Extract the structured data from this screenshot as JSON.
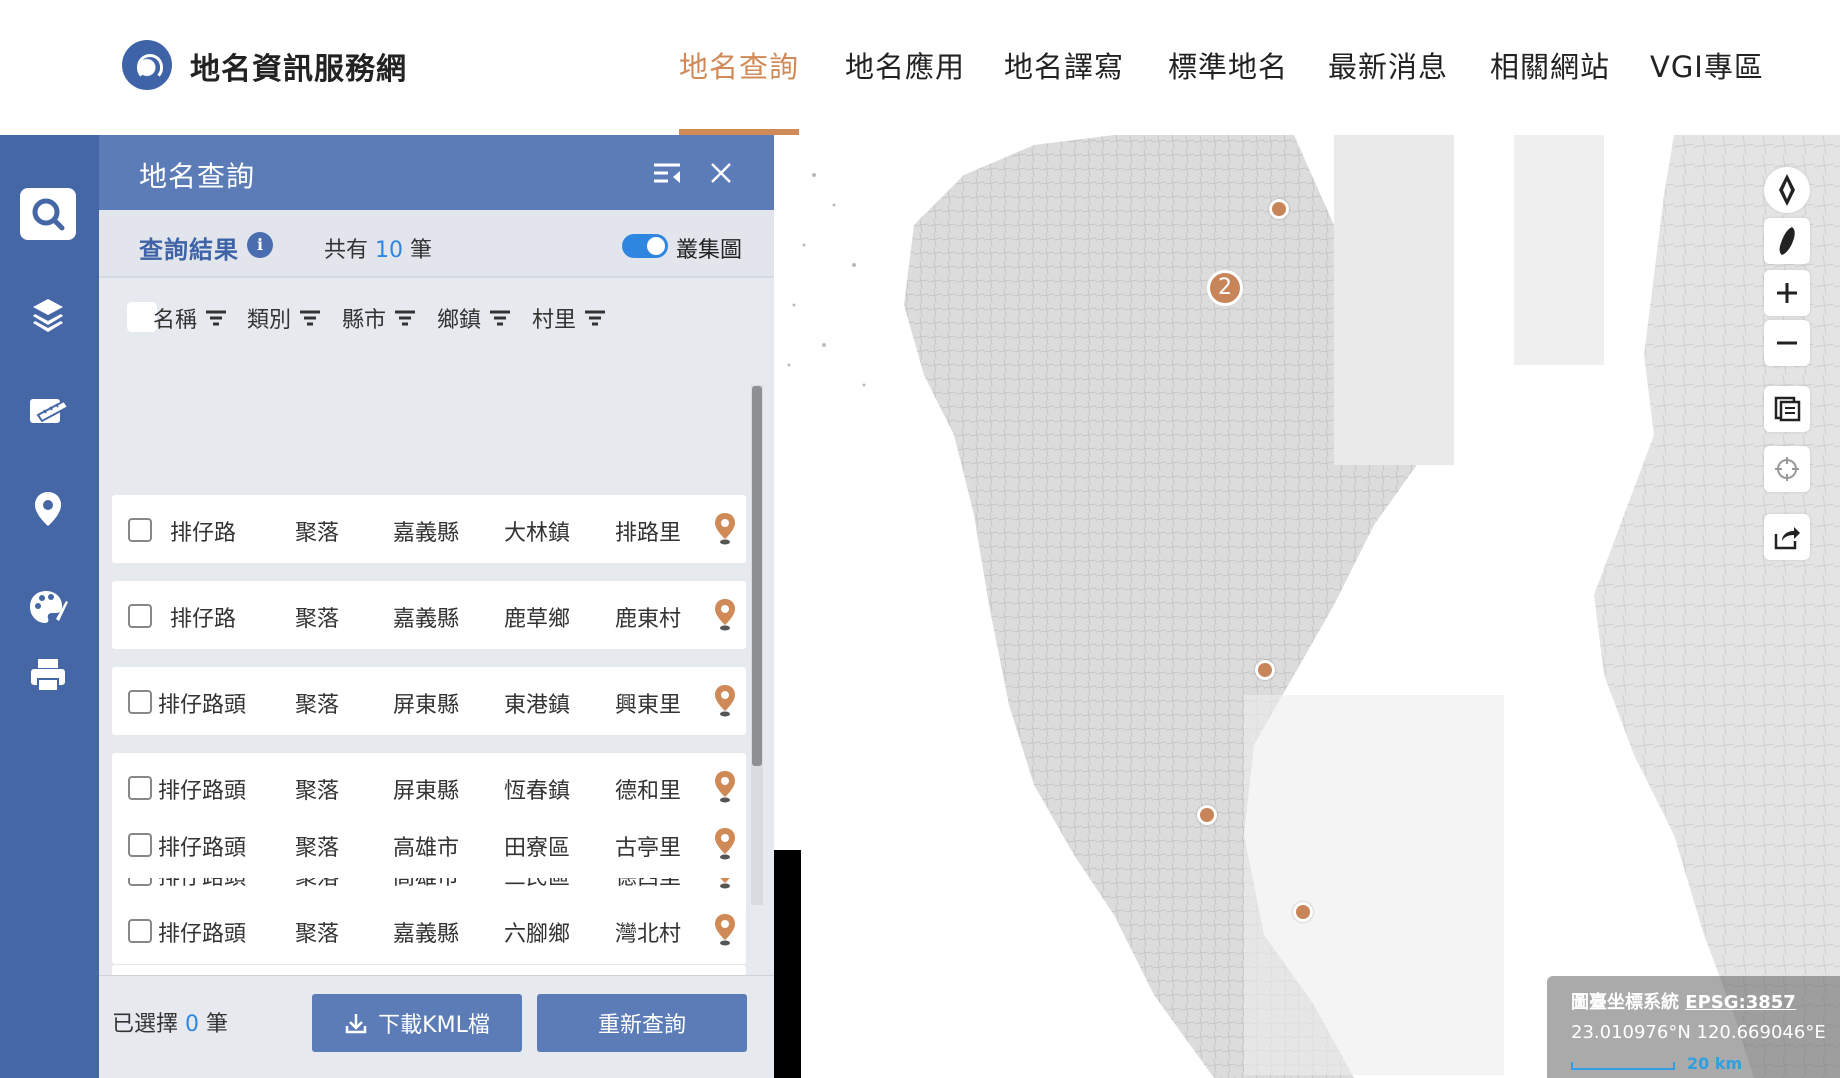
{
  "site": {
    "title": "地名資訊服務網"
  },
  "nav": {
    "items": [
      {
        "label": "地名查詢",
        "active": true
      },
      {
        "label": "地名應用",
        "active": false
      },
      {
        "label": "地名譯寫",
        "active": false
      },
      {
        "label": "標準地名",
        "active": false
      },
      {
        "label": "最新消息",
        "active": false
      },
      {
        "label": "相關網站",
        "active": false
      },
      {
        "label": "VGI專區",
        "active": false
      }
    ]
  },
  "rail": {
    "icons": [
      "search-icon",
      "layers-icon",
      "measure-icon",
      "location-pin-icon",
      "palette-icon",
      "print-icon"
    ]
  },
  "panel": {
    "title": "地名查詢",
    "result_title": "查詢結果",
    "count_prefix": "共有",
    "count": "10",
    "count_suffix": "筆",
    "cluster_label": "叢集圖",
    "cluster_on": true,
    "columns": [
      "名稱",
      "類別",
      "縣市",
      "鄉鎮",
      "村里"
    ],
    "rows": [
      {
        "name": "排仔路",
        "type": "聚落",
        "county": "嘉義縣",
        "town": "大林鎮",
        "village": "排路里"
      },
      {
        "name": "排仔路",
        "type": "聚落",
        "county": "嘉義縣",
        "town": "鹿草鄉",
        "village": "鹿東村"
      },
      {
        "name": "排仔路頭",
        "type": "聚落",
        "county": "屏東縣",
        "town": "東港鎮",
        "village": "興東里"
      },
      {
        "name": "排仔路頭",
        "type": "聚落",
        "county": "屏東縣",
        "town": "恆春鎮",
        "village": "德和里"
      },
      {
        "name": "排仔路頭",
        "type": "聚落",
        "county": "高雄市",
        "town": "三民區",
        "village": "德西里"
      },
      {
        "name": "排仔路頭",
        "type": "聚落",
        "county": "高雄市",
        "town": "田寮區",
        "village": "古亭里"
      },
      {
        "name": "排仔路頭",
        "type": "聚落",
        "county": "嘉義縣",
        "town": "六腳鄉",
        "village": "灣北村"
      }
    ],
    "footer": {
      "selected_prefix": "已選擇",
      "selected_count": "0",
      "selected_suffix": "筆",
      "download_label": "下載KML檔",
      "requery_label": "重新查詢"
    }
  },
  "map": {
    "cluster_count": "2",
    "controls": [
      "compass-icon",
      "taiwan-icon",
      "zoom-in-icon",
      "zoom-out-icon",
      "legend-icon",
      "locate-icon",
      "share-icon"
    ],
    "coord_system_label": "圖臺坐標系統",
    "coord_system_code": "EPSG:3857",
    "coordinates": "23.010976°N 120.669046°E",
    "scale_label": "20 km"
  },
  "colors": {
    "accent": "#d08a57",
    "brand": "#4567a6",
    "panel_header": "#5c7cb8",
    "link": "#2f86e0"
  }
}
